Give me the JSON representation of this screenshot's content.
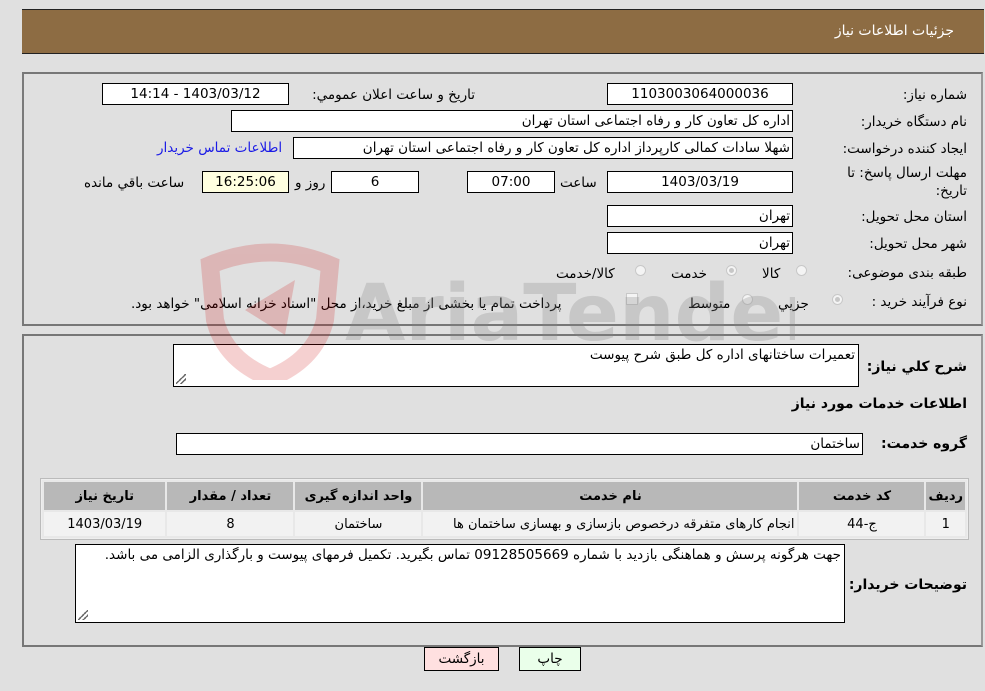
{
  "header": {
    "title": "جزئیات اطلاعات نیاز"
  },
  "form": {
    "need_number_label": "شماره نیاز:",
    "need_number": "1103003064000036",
    "announce_label": "تاریخ و ساعت اعلان عمومي:",
    "announce_value": "1403/03/12 - 14:14",
    "buyer_org_label": "نام دستگاه خریدار:",
    "buyer_org": "اداره کل تعاون  کار و رفاه اجتماعی استان تهران",
    "creator_label": "ایجاد کننده درخواست:",
    "creator": "شهلا سادات کمالی کارپرداز اداره کل تعاون  کار و رفاه اجتماعی استان تهران",
    "contact_link": "اطلاعات تماس خریدار",
    "deadline_label_1": "مهلت ارسال پاسخ: تا",
    "deadline_label_2": "تاریخ:",
    "deadline_date": "1403/03/19",
    "time_label": "ساعت",
    "deadline_time": "07:00",
    "days_value": "6",
    "days_label": "روز و",
    "remaining_time": "16:25:06",
    "remaining_label": "ساعت باقي مانده",
    "province_label": "استان محل تحویل:",
    "province": "تهران",
    "city_label": "شهر محل تحویل:",
    "city": "تهران",
    "category_label": "طبقه بندی موضوعی:",
    "category_options": [
      {
        "label": "کالا",
        "checked": false
      },
      {
        "label": "خدمت",
        "checked": true
      },
      {
        "label": "کالا/خدمت",
        "checked": false
      }
    ],
    "process_label": "نوع فرآیند خرید :",
    "process_options": [
      {
        "label": "جزيي",
        "checked": true
      },
      {
        "label": "متوسط",
        "checked": false
      }
    ],
    "treasury_note": "پرداخت تمام یا بخشی از مبلغ خرید،از محل \"اسناد خزانه اسلامی\" خواهد بود."
  },
  "details": {
    "description_label": "شرح کلي نیاز:",
    "description": "تعمیرات ساختانهای اداره کل طبق شرح پیوست",
    "services_heading": "اطلاعات خدمات مورد نیاز",
    "service_group_label": "گروه خدمت:",
    "service_group": "ساختمان",
    "table": {
      "headers": [
        "ردیف",
        "کد خدمت",
        "نام خدمت",
        "واحد اندازه گیری",
        "تعداد / مقدار",
        "تاریخ نیاز"
      ],
      "rows": [
        [
          "1",
          "ج-44",
          "انجام کارهای متفرقه درخصوص بازسازی و بهسازی ساختمان ها",
          "ساختمان",
          "8",
          "1403/03/19"
        ]
      ]
    },
    "buyer_notes_label": "توضیحات خریدار:",
    "buyer_notes": "جهت هرگونه پرسش و هماهنگی بازدید با شماره 09128505669 تماس بگیرید. تکمیل فرمهای پیوست و بارگذاری الزامی می باشد."
  },
  "buttons": {
    "print": "چاپ",
    "back": "بازگشت"
  },
  "watermark": {
    "text": "AriaTender.neT"
  }
}
